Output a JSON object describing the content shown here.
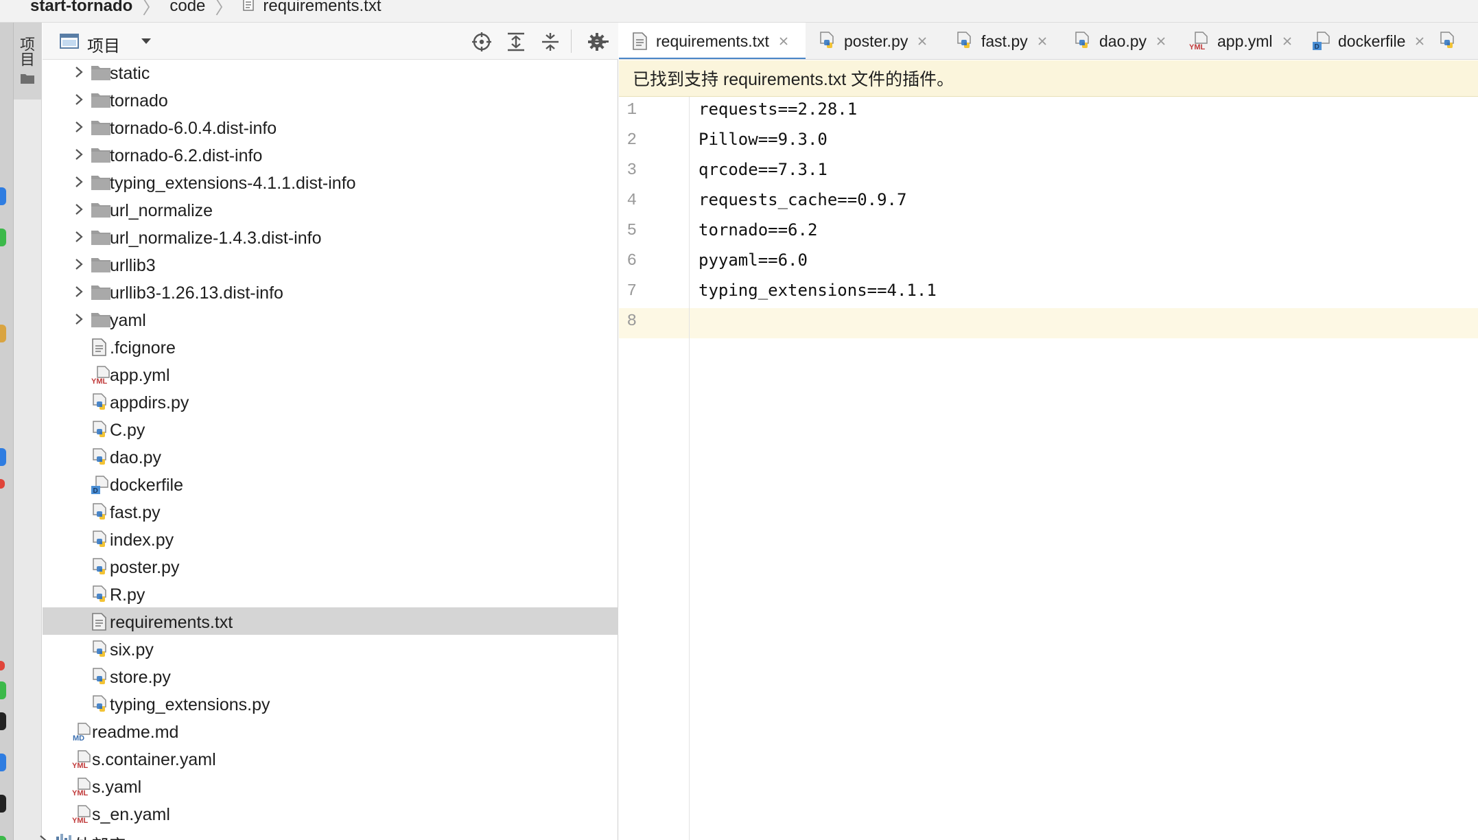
{
  "breadcrumb": {
    "project": "start-tornado",
    "folder": "code",
    "file": "requirements.txt"
  },
  "tool_window": {
    "label": "项目"
  },
  "project_panel": {
    "view_title": "项目",
    "tree": [
      {
        "label": "static",
        "type": "folder"
      },
      {
        "label": "tornado",
        "type": "folder"
      },
      {
        "label": "tornado-6.0.4.dist-info",
        "type": "folder"
      },
      {
        "label": "tornado-6.2.dist-info",
        "type": "folder"
      },
      {
        "label": "typing_extensions-4.1.1.dist-info",
        "type": "folder"
      },
      {
        "label": "url_normalize",
        "type": "folder"
      },
      {
        "label": "url_normalize-1.4.3.dist-info",
        "type": "folder"
      },
      {
        "label": "urllib3",
        "type": "folder"
      },
      {
        "label": "urllib3-1.26.13.dist-info",
        "type": "folder"
      },
      {
        "label": "yaml",
        "type": "folder"
      },
      {
        "label": ".fcignore",
        "type": "text"
      },
      {
        "label": "app.yml",
        "type": "yml"
      },
      {
        "label": "appdirs.py",
        "type": "py"
      },
      {
        "label": "C.py",
        "type": "py"
      },
      {
        "label": "dao.py",
        "type": "py"
      },
      {
        "label": "dockerfile",
        "type": "docker"
      },
      {
        "label": "fast.py",
        "type": "py"
      },
      {
        "label": "index.py",
        "type": "py"
      },
      {
        "label": "poster.py",
        "type": "py"
      },
      {
        "label": "R.py",
        "type": "py"
      },
      {
        "label": "requirements.txt",
        "type": "text",
        "selected": true
      },
      {
        "label": "six.py",
        "type": "py"
      },
      {
        "label": "store.py",
        "type": "py"
      },
      {
        "label": "typing_extensions.py",
        "type": "py"
      },
      {
        "label": "readme.md",
        "type": "md"
      },
      {
        "label": "s.container.yaml",
        "type": "yml"
      },
      {
        "label": "s.yaml",
        "type": "yml"
      },
      {
        "label": "s_en.yaml",
        "type": "yml"
      },
      {
        "label": "外部库",
        "type": "library"
      }
    ]
  },
  "editor": {
    "tabs": [
      {
        "label": "requirements.txt",
        "type": "text",
        "active": true
      },
      {
        "label": "poster.py",
        "type": "py"
      },
      {
        "label": "fast.py",
        "type": "py"
      },
      {
        "label": "dao.py",
        "type": "py"
      },
      {
        "label": "app.yml",
        "type": "yml"
      },
      {
        "label": "dockerfile",
        "type": "docker"
      }
    ],
    "notification": "已找到支持 requirements.txt 文件的插件。",
    "lines": [
      "requests==2.28.1",
      "Pillow==9.3.0",
      "qrcode==7.3.1",
      "requests_cache==0.9.7",
      "tornado==6.2",
      "pyyaml==6.0",
      "typing_extensions==4.1.1",
      ""
    ],
    "current_line": 8
  },
  "colors": {
    "accent": "#4a86c8",
    "notification_bg": "#fbf5dc",
    "current_line_bg": "#fdf8e4",
    "selection_bg": "#d5d5d5"
  }
}
